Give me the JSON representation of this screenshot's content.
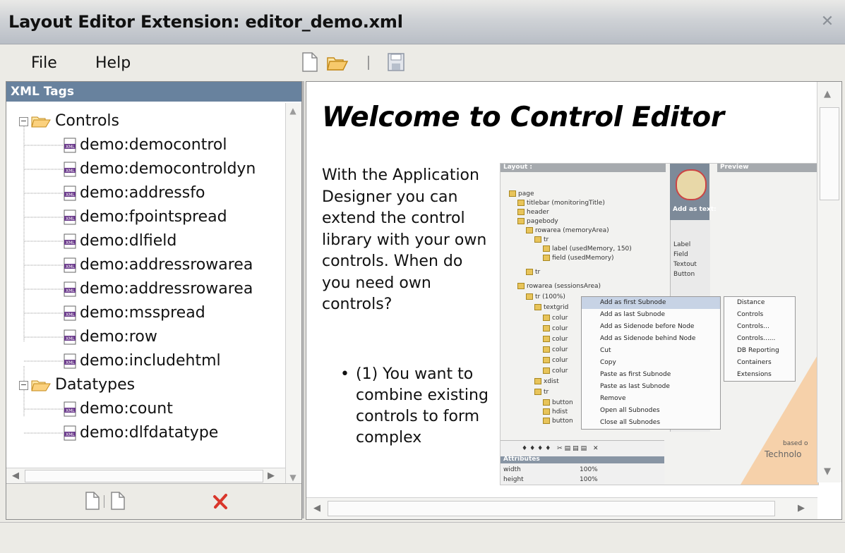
{
  "window": {
    "title": "Layout Editor Extension: editor_demo.xml",
    "close_icon": "close-icon"
  },
  "menu": {
    "file": "File",
    "help": "Help"
  },
  "toolbar": {
    "icons": [
      "new-document-icon",
      "open-folder-icon",
      "save-icon"
    ]
  },
  "xml_panel": {
    "header": "XML Tags",
    "groups": [
      {
        "label": "Controls",
        "items": [
          "demo:democontrol",
          "demo:democontroldyn",
          "demo:addressfo",
          "demo:fpointspread",
          "demo:dlfield",
          "demo:addressrowarea",
          "demo:addressrowarea",
          "demo:msspread",
          "demo:row",
          "demo:includehtml"
        ]
      },
      {
        "label": "Datatypes",
        "items": [
          "demo:count",
          "demo:dlfdatatype"
        ]
      }
    ]
  },
  "content": {
    "heading": "Welcome to Control Editor",
    "intro": "With the Application Designer you can extend the control library with your own controls. When do you need own controls?",
    "bullet": "(1) You want to combine existing controls to form complex"
  },
  "screenshot": {
    "layout_label": "Layout :",
    "preview_label": "Preview",
    "add_as_text": "Add as text:",
    "tree": [
      "page",
      "titlebar (monitoringTitle)",
      "header",
      "pagebody",
      "rowarea (memoryArea)",
      "tr",
      "label (usedMemory, 150)",
      "field (usedMemory)",
      "tr",
      "rowarea (sessionsArea)",
      "tr (100%)",
      "textgrid",
      "colur",
      "colur",
      "colur",
      "colur",
      "colur",
      "colur",
      "xdist",
      "tr",
      "button",
      "hdist",
      "button"
    ],
    "context_menu": [
      "Add as first Subnode",
      "Add as last Subnode",
      "Add as Sidenode before Node",
      "Add as Sidenode behind Node",
      "Cut",
      "Copy",
      "Paste as first Subnode",
      "Paste as last Subnode",
      "Remove",
      "Open all Subnodes",
      "Close all Subnodes"
    ],
    "submenu": [
      "Distance",
      "Controls",
      "Controls...",
      "Controls......",
      "DB Reporting",
      "Containers",
      "Extensions"
    ],
    "side_labels": [
      "Label",
      "Field",
      "Textout",
      "Button"
    ],
    "attributes_label": "Attributes",
    "attrs": [
      {
        "name": "width",
        "value": "100%"
      },
      {
        "name": "height",
        "value": "100%"
      }
    ],
    "based_on": "based o",
    "technolo": "Technolo"
  }
}
